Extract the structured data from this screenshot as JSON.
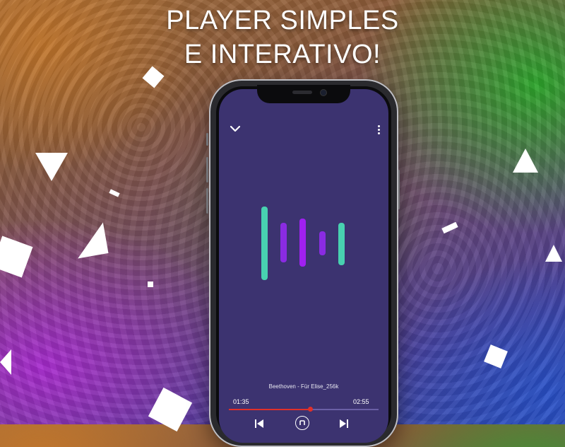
{
  "promo": {
    "headline_line1": "PLAYER SIMPLES",
    "headline_line2": "E INTERATIVO!"
  },
  "player": {
    "track_title": "Beethoven - Für Elise_256k",
    "elapsed": "01:35",
    "duration": "02:55",
    "progress": 0.5429,
    "icons": {
      "collapse": "chevron-down-icon",
      "menu": "more-vertical-icon",
      "previous": "skip-previous-icon",
      "play_pause": "play-pause-icon",
      "next": "skip-next-icon"
    },
    "visualizer_colors": [
      "#48d1b0",
      "#8a2be2",
      "#a020f0",
      "#8a2be2",
      "#48d1b0"
    ]
  },
  "colors": {
    "screen_bg": "#3c3370",
    "accent": "#e0302a",
    "text": "#ffffff"
  }
}
